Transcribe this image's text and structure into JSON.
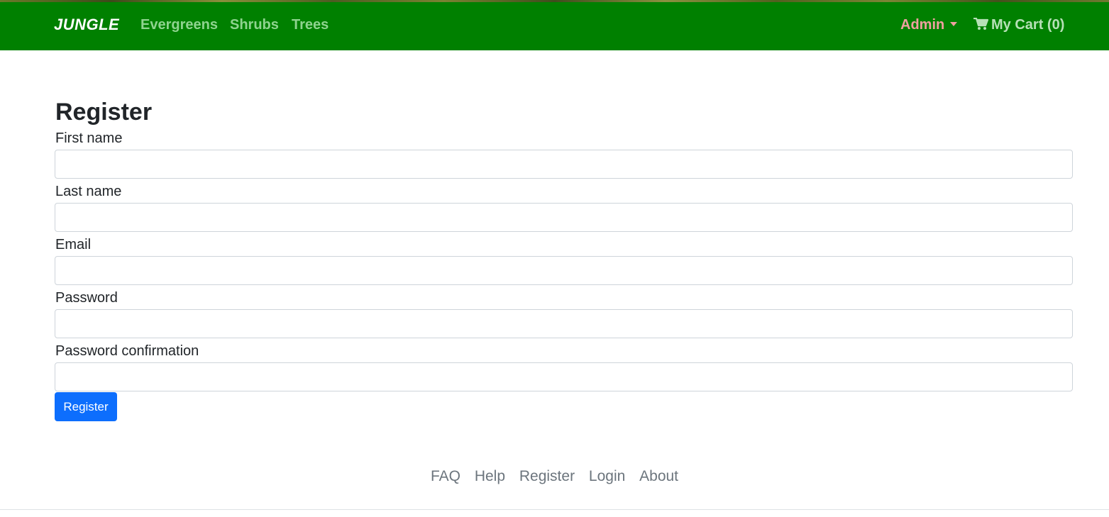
{
  "navbar": {
    "brand": "JUNGLE",
    "links": [
      "Evergreens",
      "Shrubs",
      "Trees"
    ],
    "admin_label": "Admin",
    "cart_label": "My Cart (0)",
    "colors": {
      "background": "#008000",
      "link": "#8fd38f",
      "admin": "#f0a0a0"
    },
    "icons": {
      "cart": "shopping-cart-icon",
      "admin_caret": "caret-down-icon"
    }
  },
  "form": {
    "title": "Register",
    "fields": [
      {
        "label": "First name",
        "value": ""
      },
      {
        "label": "Last name",
        "value": ""
      },
      {
        "label": "Email",
        "value": ""
      },
      {
        "label": "Password",
        "value": ""
      },
      {
        "label": "Password confirmation",
        "value": ""
      }
    ],
    "submit_label": "Register",
    "submit_color": "#0d6efd"
  },
  "footer": {
    "links": [
      "FAQ",
      "Help",
      "Register",
      "Login",
      "About"
    ]
  }
}
